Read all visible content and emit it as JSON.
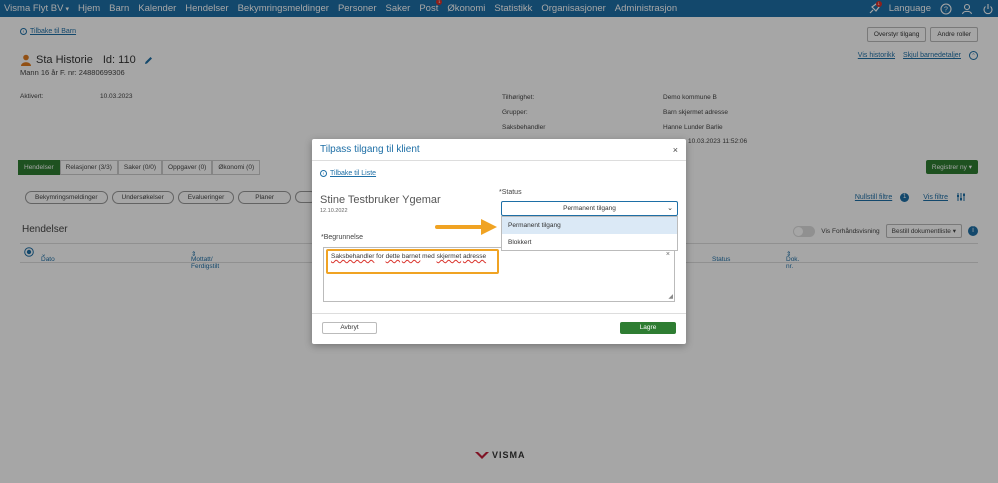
{
  "nav": {
    "brand": "Visma Flyt BV",
    "items": [
      "Hjem",
      "Barn",
      "Kalender",
      "Hendelser",
      "Bekymringsmeldinger",
      "Personer",
      "Saker",
      "Post",
      "Økonomi",
      "Statistikk",
      "Organisasjoner",
      "Administrasjon"
    ],
    "post_badge": "1",
    "language": "Language",
    "rocket_badge": "1"
  },
  "page": {
    "back_link": "Tilbake til Barn",
    "btn_override": "Overstyr tilgang",
    "btn_other_roles": "Andre roller",
    "person_name": "Sta Historie",
    "person_id": "Id: 110",
    "person_sub": "Mann 16 år   F. nr: 24880699306",
    "link_history": "Vis historikk",
    "link_hide": "Skjul barnedetaljer",
    "aktivert_label": "Aktivert:",
    "aktivert_value": "10.03.2023",
    "right_labels": [
      "Tilhørighet:",
      "Grupper:",
      "Saksbehandler"
    ],
    "right_values": [
      "Demo kommune B",
      "Barn skjermet adresse",
      "Hanne Lunder Barlie",
      "10.03.2023 11:52:06"
    ],
    "tabs": [
      "Hendelser",
      "Relasjoner (3/3)",
      "Saker (0/0)",
      "Oppgaver (0)",
      "Økonomi (0)"
    ],
    "register_btn": "Registrer ny",
    "chips": [
      "Bekymringsmeldinger",
      "Undersøkelser",
      "Evalueringer",
      "Planer",
      ""
    ],
    "reset_filters": "Nullstill filtre",
    "reset_badge": "1",
    "show_filters": "Vis filtre",
    "section_title": "Hendelser",
    "preview_label": "Vis Forhåndsvisning",
    "order_btn": "Bestill dokumentliste",
    "columns": [
      "Dato",
      "Mottatt/ Ferdigstilt",
      "Status",
      "Dok. nr."
    ]
  },
  "modal": {
    "title": "Tilpass tilgang til klient",
    "close": "×",
    "back_link": "Tilbake til Liste",
    "client_name": "Stine Testbruker Ygemar",
    "client_date": "12.10.2022",
    "status_label": "*Status",
    "status_value": "Permanent tilgang",
    "options": [
      "Permanent tilgang",
      "Blokkert"
    ],
    "reason_label": "*Begrunnelse",
    "reason_words": [
      "Saksbehandler",
      " for ",
      "dette",
      " ",
      "barnet",
      " med ",
      "skjermet",
      " ",
      "adresse"
    ],
    "cancel": "Avbryt",
    "save": "Lagre"
  },
  "footer": {
    "logo": "VISMA"
  },
  "colors": {
    "nav": "#1e6fa6",
    "primary_green": "#2e7d32",
    "highlight": "#f0a323"
  }
}
